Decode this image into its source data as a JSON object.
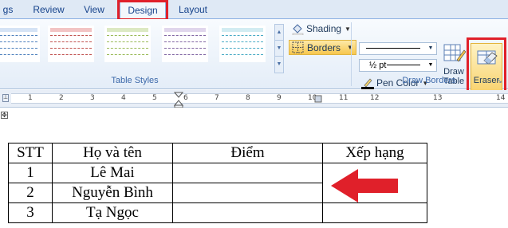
{
  "tabs": [
    {
      "label": "gs",
      "active": false
    },
    {
      "label": "Review",
      "active": false
    },
    {
      "label": "View",
      "active": false
    },
    {
      "label": "Design",
      "active": true
    },
    {
      "label": "Layout",
      "active": false
    }
  ],
  "ribbon": {
    "table_styles_label": "Table Styles",
    "shading_label": "Shading",
    "borders_label": "Borders",
    "line_weight_value": "½ pt",
    "pen_color_label": "Pen Color",
    "draw_table_label_1": "Draw",
    "draw_table_label_2": "Table",
    "eraser_label": "Eraser",
    "draw_borders_label": "Draw Borders"
  },
  "ruler": {
    "numbers": [
      "1",
      "2",
      "3",
      "4",
      "5",
      "6",
      "7",
      "8",
      "9",
      "10",
      "11",
      "12",
      "13",
      "14"
    ]
  },
  "table": {
    "headers": [
      "STT",
      "Họ và tên",
      "Điểm",
      "Xếp hạng"
    ],
    "rows": [
      {
        "stt": "1",
        "name": "Lê Mai"
      },
      {
        "stt": "2",
        "name": "Nguyễn Bình"
      },
      {
        "stt": "3",
        "name": "Tạ Ngọc"
      }
    ]
  },
  "colors": {
    "highlight": "#e0202a",
    "arrow": "#e0202a",
    "ribbon_accent": "#f7c74e"
  }
}
